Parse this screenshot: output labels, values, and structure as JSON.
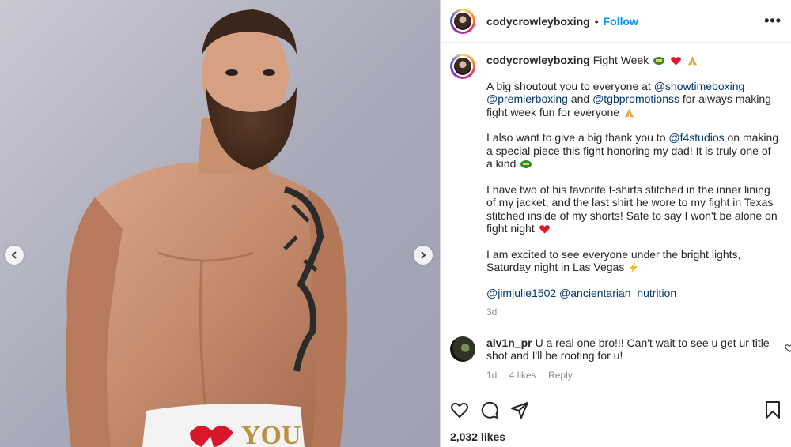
{
  "post": {
    "username": "codycrowleyboxing",
    "separator": "•",
    "follow_label": "Follow",
    "more_label": "•••"
  },
  "caption": {
    "username": "codycrowleyboxing",
    "title": "Fight Week",
    "p1_a": "A big shoutout you to everyone at",
    "m_showtime": "@showtimeboxing",
    "m_premier": "@premierboxing",
    "and": "and",
    "m_tgb": "@tgbpromotionss",
    "p1_b": "for always making fight week fun for everyone",
    "p2_a": "I also want to give a big thank you to",
    "m_f4": "@f4studios",
    "p2_b": "on making a special piece this fight honoring my dad! It is truly one of a kind",
    "p3": "I have two of his favorite t-shirts stitched in the inner lining of my jacket, and the last shirt he wore to my fight in Texas stitched inside of my shorts! Safe to say I won't be alone on fight night",
    "p4": "I am excited to see everyone under the bright lights, Saturday night in Las Vegas",
    "m_jim": "@jimjulie1502",
    "m_anc": "@ancientarian_nutrition",
    "time": "3d"
  },
  "comment": {
    "username": "alv1n_pr",
    "text": "U a real one bro!!! Can't wait to see u get ur title shot and I'll be rooting for u!",
    "time": "1d",
    "likes": "4 likes",
    "reply": "Reply"
  },
  "likes_text": "2,032 likes",
  "colors": {
    "link": "#00376b",
    "follow": "#0095f6",
    "muted": "#8e8e8e"
  },
  "icons": [
    "chevron-left-icon",
    "chevron-right-icon",
    "heart-icon",
    "comment-icon",
    "share-icon",
    "bookmark-icon",
    "boxing-glove-emoji",
    "red-heart-emoji",
    "folded-hands-emoji",
    "lightning-emoji"
  ]
}
